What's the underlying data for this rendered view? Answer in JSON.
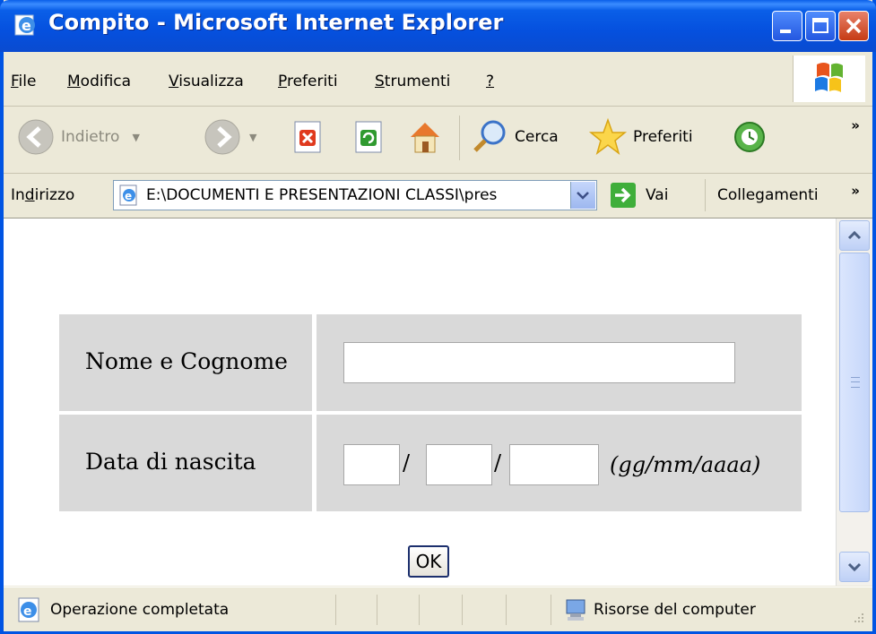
{
  "window": {
    "title": "Compito - Microsoft Internet Explorer"
  },
  "menu": {
    "items": [
      {
        "label": "File",
        "accel": "F",
        "rest": "ile"
      },
      {
        "label": "Modifica",
        "accel": "M",
        "rest": "odifica"
      },
      {
        "label": "Visualizza",
        "accel": "V",
        "rest": "isualizza"
      },
      {
        "label": "Preferiti",
        "accel": "P",
        "rest": "referiti"
      },
      {
        "label": "Strumenti",
        "accel": "S",
        "rest": "trumenti"
      },
      {
        "label": "?",
        "accel": "?",
        "rest": ""
      }
    ]
  },
  "toolbar": {
    "back_label": "Indietro",
    "search_label": "Cerca",
    "favorites_label": "Preferiti",
    "overflow": "»"
  },
  "address": {
    "label_pre": "In",
    "label_accel": "d",
    "label_post": "irizzo",
    "url": "E:\\DOCUMENTI E PRESENTAZIONI CLASSI\\pres",
    "go_label": "Vai",
    "links_label": "Collegamenti",
    "overflow": "»"
  },
  "form": {
    "name_label": "Nome e Cognome",
    "name_value": "",
    "dob_label": "Data di nascita",
    "day_value": "",
    "month_value": "",
    "year_value": "",
    "slash": "/",
    "format_hint": "(gg/mm/aaaa)",
    "ok_label": "OK"
  },
  "status": {
    "text": "Operazione completata",
    "zone": "Risorse del computer"
  }
}
